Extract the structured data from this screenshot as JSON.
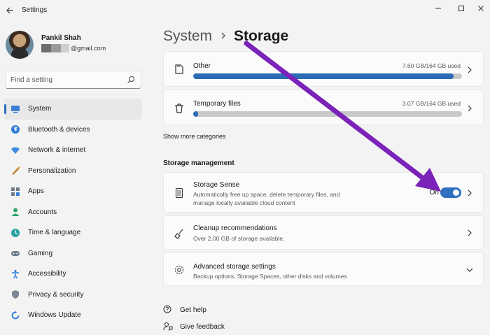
{
  "window": {
    "title": "Settings",
    "controls": [
      "minimize-icon",
      "maximize-icon",
      "close-icon"
    ]
  },
  "profile": {
    "name": "Pankil Shah",
    "email_suffix": "@gmail.com"
  },
  "search": {
    "placeholder": "Find a setting"
  },
  "sidebar": {
    "items": [
      {
        "label": "System",
        "icon": "system-icon",
        "active": true
      },
      {
        "label": "Bluetooth & devices",
        "icon": "bluetooth-icon"
      },
      {
        "label": "Network & internet",
        "icon": "network-icon"
      },
      {
        "label": "Personalization",
        "icon": "personalization-icon"
      },
      {
        "label": "Apps",
        "icon": "apps-icon"
      },
      {
        "label": "Accounts",
        "icon": "accounts-icon"
      },
      {
        "label": "Time & language",
        "icon": "time-language-icon"
      },
      {
        "label": "Gaming",
        "icon": "gaming-icon"
      },
      {
        "label": "Accessibility",
        "icon": "accessibility-icon"
      },
      {
        "label": "Privacy & security",
        "icon": "privacy-icon"
      },
      {
        "label": "Windows Update",
        "icon": "windows-update-icon"
      }
    ]
  },
  "breadcrumb": {
    "parent": "System",
    "current": "Storage"
  },
  "categories": [
    {
      "label": "Other",
      "usage": "7.60 GB/164 GB used",
      "fraction": 0.97,
      "icon": "document-icon"
    },
    {
      "label": "Temporary files",
      "usage": "3.07 GB/164 GB used",
      "fraction": 0.018,
      "icon": "trash-icon"
    }
  ],
  "show_more": "Show more categories",
  "storage_management": {
    "heading": "Storage management",
    "storage_sense": {
      "title": "Storage Sense",
      "description_line1": "Automatically free up space, delete temporary files, and",
      "description_line2": "manage locally available cloud content",
      "toggle_label": "On",
      "toggle_on": true
    },
    "cleanup": {
      "title": "Cleanup recommendations",
      "description": "Over 2.00 GB of storage available."
    },
    "advanced": {
      "title": "Advanced storage settings",
      "description": "Backup options, Storage Spaces, other disks and volumes"
    }
  },
  "footer_links": {
    "help": "Get help",
    "feedback": "Give feedback"
  },
  "colors": {
    "accent": "#2f6fbf",
    "annotation_arrow": "#7b22b8"
  }
}
